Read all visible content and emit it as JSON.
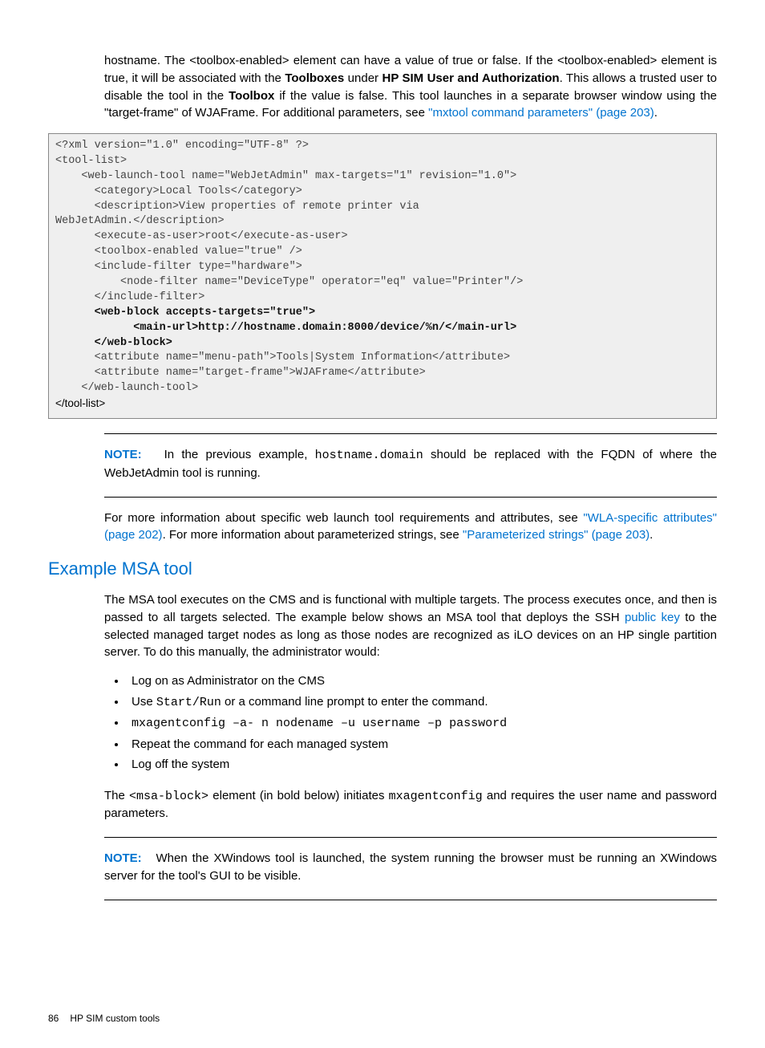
{
  "para1": {
    "pre": "hostname. The <toolbox-enabled> element can have a value of true or false. If the <toolbox-enabled> element is true, it will be associated with the ",
    "toolboxes": "Toolboxes",
    "under": " under ",
    "hpsim": "HP SIM User and Authorization",
    "post1": ". This allows a trusted user to disable the tool in the ",
    "toolbox": "Toolbox",
    "post2": " if the value is false. This tool launches in a separate browser window using the \"target-frame\" of WJAFrame. For additional parameters, see ",
    "link": "\"mxtool command parameters\" (page 203)",
    "end": "."
  },
  "note1": {
    "label": "NOTE:",
    "text1": "In the previous example, ",
    "code": "hostname.domain",
    "text2": " should be replaced with the FQDN of where the WebJetAdmin tool is running."
  },
  "para2": {
    "pre": "For more information about specific web launch tool requirements and attributes, see ",
    "link1": "\"WLA-specific attributes\" (page 202)",
    "mid": ". For more information about parameterized strings, see ",
    "link2": "\"Parameterized strings\" (page 203)",
    "end": "."
  },
  "section_heading": "Example MSA tool",
  "para3": {
    "pre": "The MSA tool executes on the CMS and is functional with multiple targets. The process executes once, and then is passed to all targets selected. The example below shows an MSA tool that deploys the SSH ",
    "link": "public key",
    "post": " to the selected managed target nodes as long as those nodes are recognized as iLO devices on an HP single partition server. To do this manually, the administrator would:"
  },
  "bullets": {
    "b1": "Log on as Administrator on the CMS",
    "b2_pre": "Use ",
    "b2_code": "Start/Run",
    "b2_post": " or a command line prompt to enter the command.",
    "b3": "mxagentconfig –a- n nodename –u username –p password",
    "b4": "Repeat the command for each managed system",
    "b5": "Log off the system"
  },
  "para4": {
    "pre": "The ",
    "code1": "<msa-block>",
    "mid": " element (in bold below) initiates ",
    "code2": "mxagentconfig",
    "post": " and requires the user name and password parameters."
  },
  "note2": {
    "label": "NOTE:",
    "text": "When the XWindows tool is launched, the system running the browser must be running an XWindows server for the tool's GUI to be visible."
  },
  "footer": {
    "pageno": "86",
    "text": "HP SIM custom tools"
  }
}
